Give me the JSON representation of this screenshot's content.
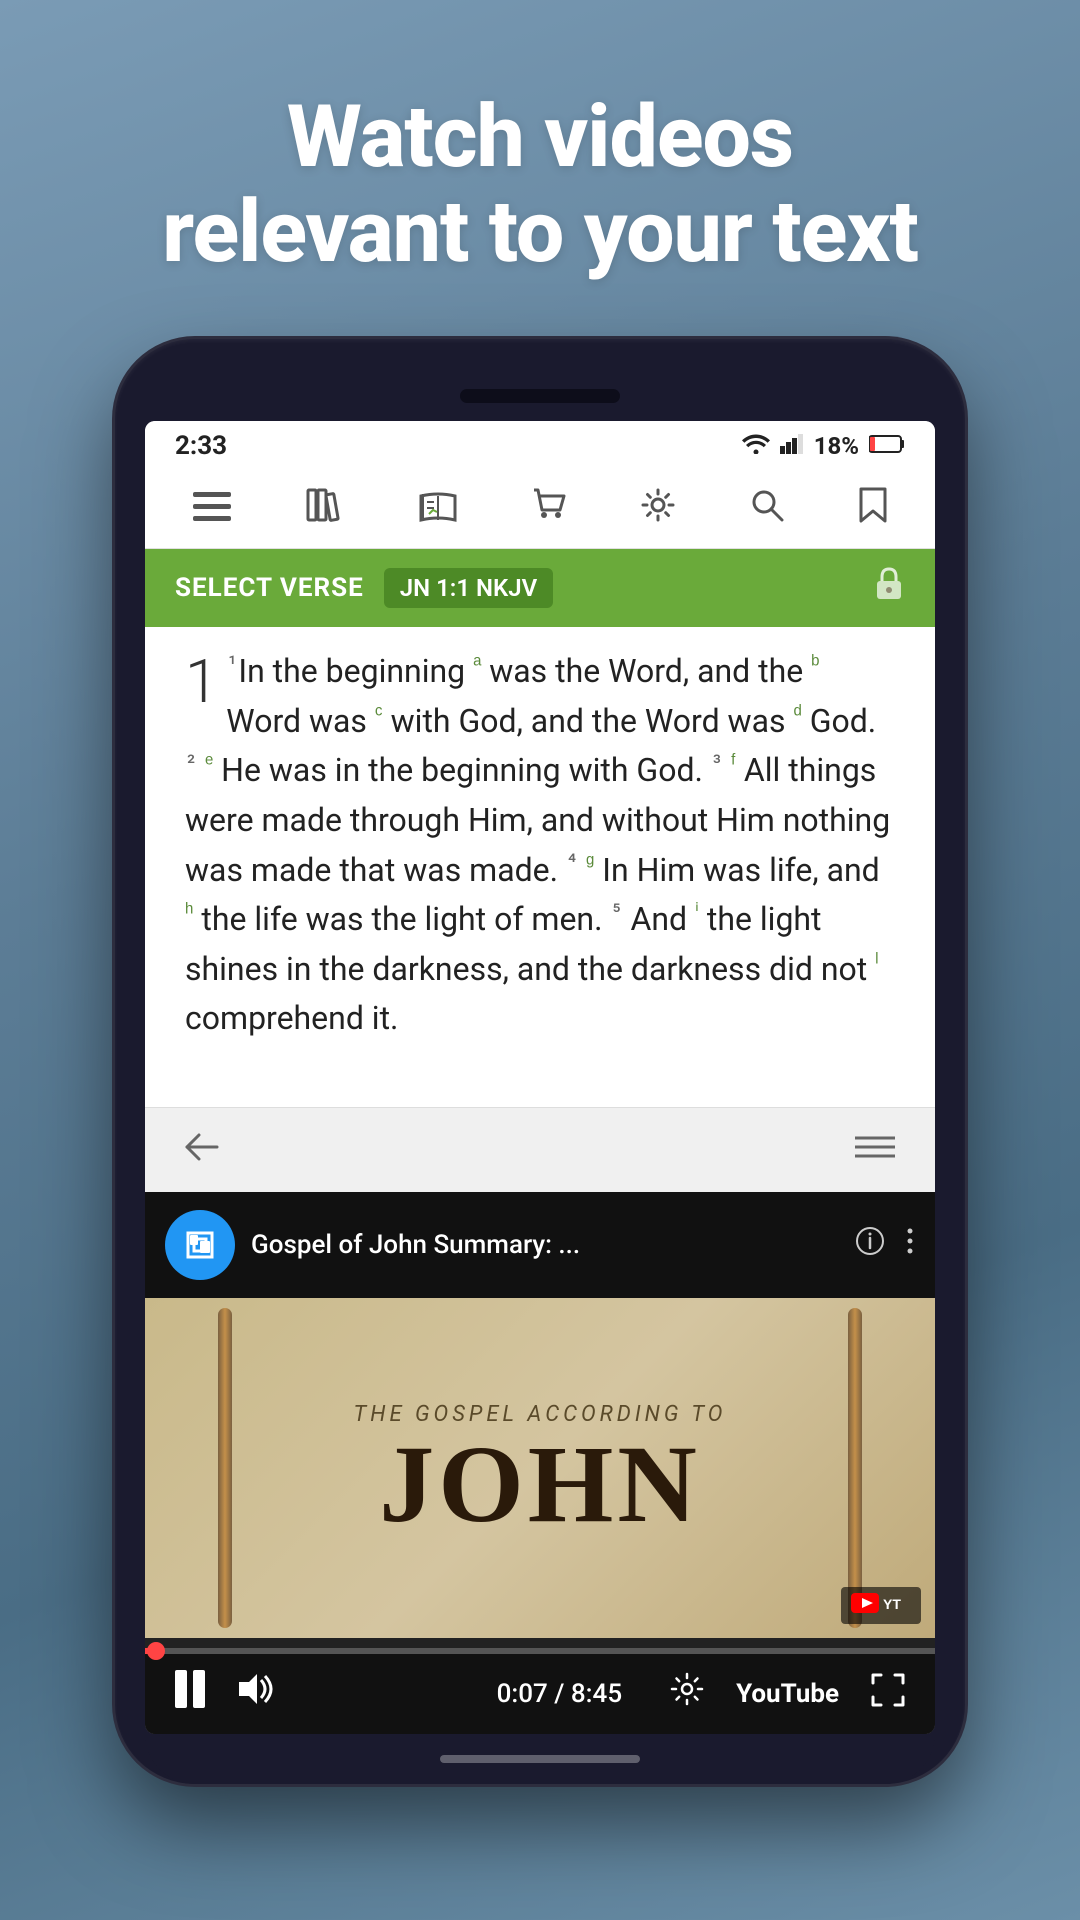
{
  "page": {
    "background_color": "#6d8fa8",
    "headline_line1": "Watch videos",
    "headline_line2": "relevant to your text"
  },
  "status_bar": {
    "time": "2:33",
    "wifi_icon": "wifi",
    "signal_icon": "signal",
    "battery": "18%"
  },
  "nav": {
    "icons": [
      "menu",
      "library",
      "bookmark-check",
      "cart",
      "settings",
      "search",
      "bookmark"
    ]
  },
  "select_verse_bar": {
    "label": "SELECT VERSE",
    "verse_ref": "JN 1:1 NKJV"
  },
  "bible_text": {
    "verse_number_display": "1",
    "content": "In the beginning was the Word, and the Word was with God, and the Word was God. He was in the beginning with God. All things were made through Him, and without Him nothing was made that was made. In Him was life, and the life was the light of men. And the light shines in the darkness, and the darkness did not comprehend it."
  },
  "video": {
    "channel_icon": "bookmark",
    "title": "Gospel of John Summary: ...",
    "info_icon": "info",
    "more_icon": "more-vertical",
    "gospel_subtitle": "THE GOSPEL ACCORDING TO",
    "gospel_title": "JOHN",
    "youtube_badge": "YouTube",
    "time_current": "0:07",
    "time_total": "8:45",
    "progress_percent": 1.4
  }
}
